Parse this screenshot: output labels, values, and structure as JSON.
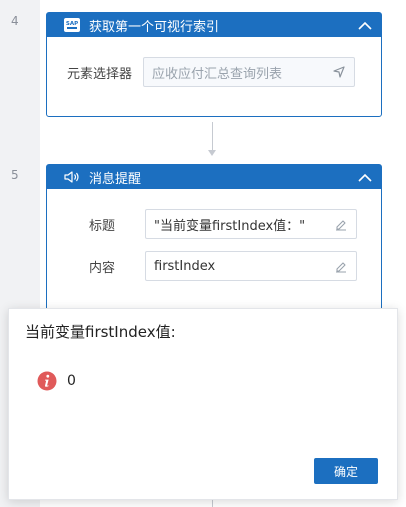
{
  "steps": [
    {
      "number": "4",
      "title": "获取第一个可视行索引",
      "icon": "sap-icon",
      "fields": [
        {
          "label": "元素选择器",
          "value": "应收应付汇总查询列表",
          "icon": "locate-arrow-icon"
        }
      ]
    },
    {
      "number": "5",
      "title": "消息提醒",
      "icon": "speaker-icon",
      "fields": [
        {
          "label": "标题",
          "value": "\"当前变量firstIndex值：\"",
          "icon": "edit-pencil-icon"
        },
        {
          "label": "内容",
          "value": "firstIndex",
          "icon": "edit-pencil-icon"
        }
      ]
    }
  ],
  "dialog": {
    "title": "当前变量firstIndex值:",
    "message": "0",
    "icon": "info-icon",
    "ok_label": "确定"
  },
  "colors": {
    "accent": "#1c6fc0",
    "info_icon": "#e05a5a",
    "placeholder_text": "#9aa3ad"
  }
}
